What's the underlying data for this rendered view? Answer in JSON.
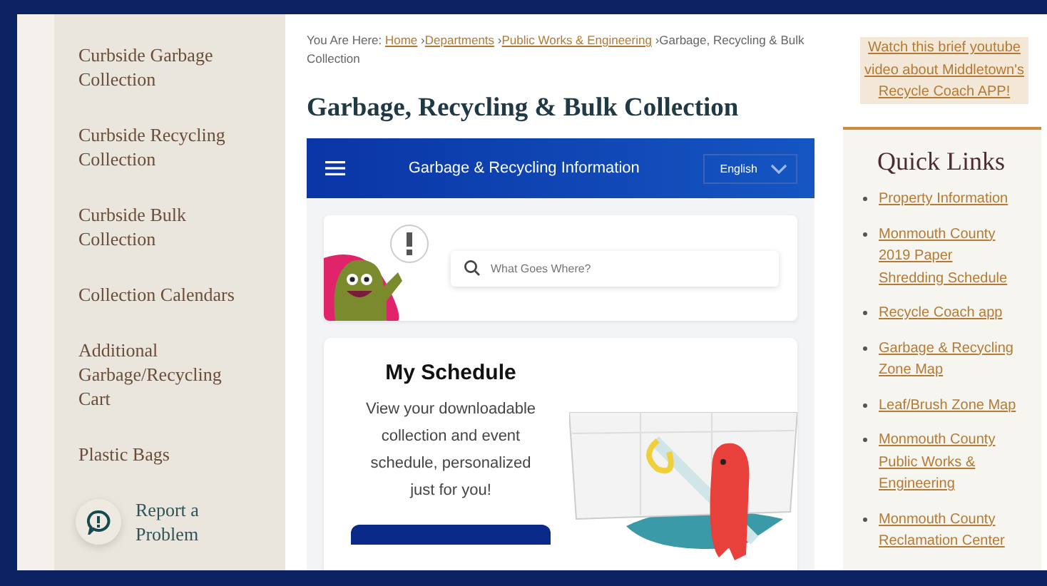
{
  "sidebar": {
    "items": [
      {
        "label": "Curbside Garbage Collection"
      },
      {
        "label": "Curbside Recycling Collection"
      },
      {
        "label": "Curbside Bulk Collection"
      },
      {
        "label": "Collection Calendars"
      },
      {
        "label": "Additional Garbage/Recycling Cart"
      },
      {
        "label": "Plastic Bags"
      }
    ],
    "report_link": {
      "label": "Report a Problem"
    }
  },
  "breadcrumb": {
    "prefix": "You Are Here:",
    "separator": "›",
    "links": [
      "Home",
      "Departments",
      "Public Works & Engineering"
    ],
    "current": "Garbage, Recycling & Bulk Collection"
  },
  "page_title": "Garbage, Recycling & Bulk Collection",
  "widget": {
    "title": "Garbage & Recycling Information",
    "language": "English",
    "search": {
      "placeholder": "What Goes Where?"
    },
    "schedule": {
      "title": "My Schedule",
      "description": "View your downloadable collection and event schedule, personalized just for you!"
    }
  },
  "video_link": "Watch this brief youtube video about Middletown's Recycle Coach APP!",
  "quick_links": {
    "title": "Quick Links",
    "items": [
      "Property Information",
      "Monmouth County 2019 Paper Shredding Schedule",
      "Recycle Coach app",
      "Garbage & Recycling Zone Map",
      "Leaf/Brush Zone Map",
      "Monmouth County Public Works & Engineering",
      "Monmouth County Reclamation Center"
    ]
  }
}
